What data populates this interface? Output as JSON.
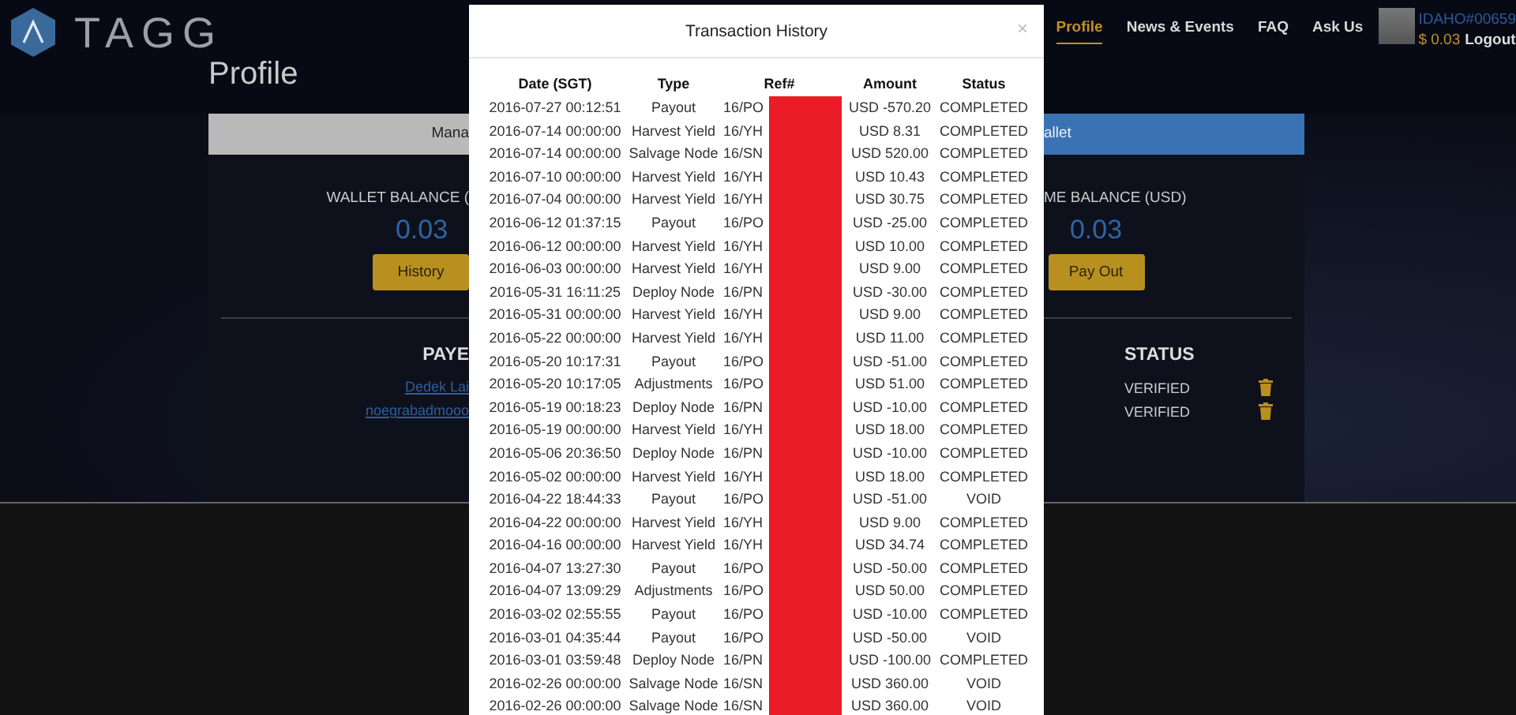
{
  "header": {
    "logo_text": "TAGG",
    "nav": [
      {
        "label": "Profile",
        "selected": true
      },
      {
        "label": "News & Events",
        "selected": false
      },
      {
        "label": "FAQ",
        "selected": false
      },
      {
        "label": "Ask Us",
        "selected": false
      }
    ],
    "user": {
      "id": "IDAHO#00659",
      "balance": "$ 0.03",
      "logout": "Logout"
    }
  },
  "page_title": "Profile",
  "tabs": [
    {
      "label": "Mana",
      "selected": false
    },
    {
      "label": "allet",
      "selected": true
    }
  ],
  "balances": [
    {
      "label": "WALLET BALANCE (",
      "value": "0.03",
      "button": "History"
    },
    {
      "label": "ME BALANCE (USD)",
      "value": "0.03",
      "button": "Pay Out"
    }
  ],
  "payees": {
    "columns": [
      "PAYE",
      "STATUS"
    ],
    "rows": [
      {
        "name": "Dedek Lai",
        "status": "VERIFIED"
      },
      {
        "name": "noegrabadmooo",
        "status": "VERIFIED"
      }
    ]
  },
  "modal": {
    "title": "Transaction History",
    "close": "×",
    "columns": [
      "Date (SGT)",
      "Type",
      "Ref#",
      "Amount",
      "Status"
    ],
    "rows": [
      [
        "2016-07-27 00:12:51",
        "Payout",
        "16/PO",
        "USD -570.20",
        "COMPLETED"
      ],
      [
        "2016-07-14 00:00:00",
        "Harvest Yield",
        "16/YH",
        "USD 8.31",
        "COMPLETED"
      ],
      [
        "2016-07-14 00:00:00",
        "Salvage Node",
        "16/SN",
        "USD 520.00",
        "COMPLETED"
      ],
      [
        "2016-07-10 00:00:00",
        "Harvest Yield",
        "16/YH",
        "USD 10.43",
        "COMPLETED"
      ],
      [
        "2016-07-04 00:00:00",
        "Harvest Yield",
        "16/YH",
        "USD 30.75",
        "COMPLETED"
      ],
      [
        "2016-06-12 01:37:15",
        "Payout",
        "16/PO",
        "USD -25.00",
        "COMPLETED"
      ],
      [
        "2016-06-12 00:00:00",
        "Harvest Yield",
        "16/YH",
        "USD 10.00",
        "COMPLETED"
      ],
      [
        "2016-06-03 00:00:00",
        "Harvest Yield",
        "16/YH",
        "USD 9.00",
        "COMPLETED"
      ],
      [
        "2016-05-31 16:11:25",
        "Deploy Node",
        "16/PN",
        "USD -30.00",
        "COMPLETED"
      ],
      [
        "2016-05-31 00:00:00",
        "Harvest Yield",
        "16/YH",
        "USD 9.00",
        "COMPLETED"
      ],
      [
        "2016-05-22 00:00:00",
        "Harvest Yield",
        "16/YH",
        "USD 11.00",
        "COMPLETED"
      ],
      [
        "2016-05-20 10:17:31",
        "Payout",
        "16/PO",
        "USD -51.00",
        "COMPLETED"
      ],
      [
        "2016-05-20 10:17:05",
        "Adjustments",
        "16/PO",
        "USD 51.00",
        "COMPLETED"
      ],
      [
        "2016-05-19 00:18:23",
        "Deploy Node",
        "16/PN",
        "USD -10.00",
        "COMPLETED"
      ],
      [
        "2016-05-19 00:00:00",
        "Harvest Yield",
        "16/YH",
        "USD 18.00",
        "COMPLETED"
      ],
      [
        "2016-05-06 20:36:50",
        "Deploy Node",
        "16/PN",
        "USD -10.00",
        "COMPLETED"
      ],
      [
        "2016-05-02 00:00:00",
        "Harvest Yield",
        "16/YH",
        "USD 18.00",
        "COMPLETED"
      ],
      [
        "2016-04-22 18:44:33",
        "Payout",
        "16/PO",
        "USD -51.00",
        "VOID"
      ],
      [
        "2016-04-22 00:00:00",
        "Harvest Yield",
        "16/YH",
        "USD 9.00",
        "COMPLETED"
      ],
      [
        "2016-04-16 00:00:00",
        "Harvest Yield",
        "16/YH",
        "USD 34.74",
        "COMPLETED"
      ],
      [
        "2016-04-07 13:27:30",
        "Payout",
        "16/PO",
        "USD -50.00",
        "COMPLETED"
      ],
      [
        "2016-04-07 13:09:29",
        "Adjustments",
        "16/PO",
        "USD 50.00",
        "COMPLETED"
      ],
      [
        "2016-03-02 02:55:55",
        "Payout",
        "16/PO",
        "USD -10.00",
        "COMPLETED"
      ],
      [
        "2016-03-01 04:35:44",
        "Payout",
        "16/PO",
        "USD -50.00",
        "VOID"
      ],
      [
        "2016-03-01 03:59:48",
        "Deploy Node",
        "16/PN",
        "USD -100.00",
        "COMPLETED"
      ],
      [
        "2016-02-26 00:00:00",
        "Salvage Node",
        "16/SN",
        "USD 360.00",
        "VOID"
      ],
      [
        "2016-02-26 00:00:00",
        "Salvage Node",
        "16/SN",
        "USD 360.00",
        "VOID"
      ]
    ]
  }
}
